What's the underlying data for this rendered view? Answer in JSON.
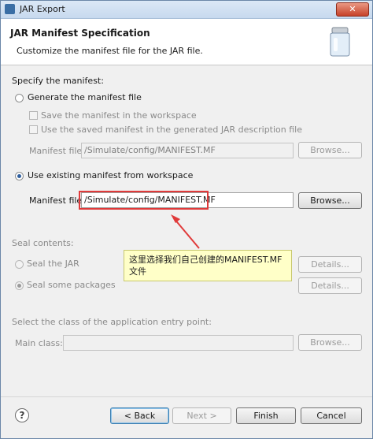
{
  "window": {
    "title": "JAR Export",
    "close_label": "✕"
  },
  "header": {
    "title": "JAR Manifest Specification",
    "description": "Customize the manifest file for the JAR file."
  },
  "specify": {
    "label": "Specify the manifest:",
    "generate_label": "Generate the manifest file",
    "save_in_workspace_label": "Save the manifest in the workspace",
    "use_saved_label": "Use the saved manifest in the generated JAR description file",
    "gen_manifest_file_label": "Manifest file:",
    "gen_manifest_file_value": "/Simulate/config/MANIFEST.MF",
    "gen_browse_label": "Browse...",
    "use_existing_label": "Use existing manifest from workspace",
    "manifest_file_label": "Manifest file:",
    "manifest_file_value": "/Simulate/config/MANIFEST.MF",
    "browse_label": "Browse..."
  },
  "seal": {
    "label": "Seal contents:",
    "seal_jar_label": "Seal the JAR",
    "seal_packages_label": "Seal some packages",
    "details1_label": "Details...",
    "details2_label": "Details..."
  },
  "main_class": {
    "section_label": "Select the class of the application entry point:",
    "label": "Main class:",
    "value": "",
    "browse_label": "Browse..."
  },
  "annotation": {
    "text": "这里选择我们自己创建的MANIFEST.MF文件",
    "colors": {
      "border": "#e03a3a",
      "callout_bg": "#ffffc8"
    }
  },
  "footer": {
    "help_label": "?",
    "back_label": "< Back",
    "next_label": "Next >",
    "finish_label": "Finish",
    "cancel_label": "Cancel"
  }
}
